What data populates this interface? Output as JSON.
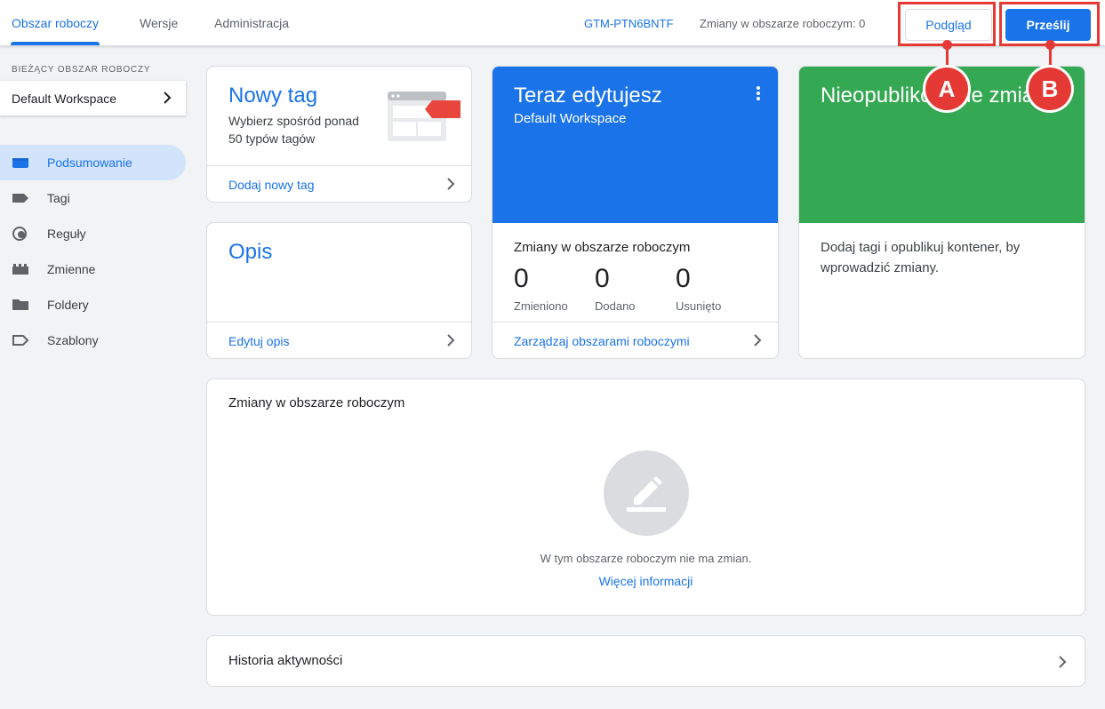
{
  "header": {
    "tabs": [
      {
        "label": "Obszar roboczy"
      },
      {
        "label": "Wersje"
      },
      {
        "label": "Administracja"
      }
    ],
    "container_id": "GTM-PTN6BNTF",
    "changes_count": "Zmiany w obszarze roboczym: 0",
    "preview_label": "Podgląd",
    "submit_label": "Prześlij"
  },
  "annotations": {
    "a": "A",
    "b": "B",
    "color": "#e53935"
  },
  "sidebar": {
    "workspace_label": "BIEŻĄCY OBSZAR ROBOCZY",
    "workspace_name": "Default Workspace",
    "items": [
      {
        "label": "Podsumowanie",
        "icon": "overview-icon"
      },
      {
        "label": "Tagi",
        "icon": "tag-icon"
      },
      {
        "label": "Reguły",
        "icon": "trigger-icon"
      },
      {
        "label": "Zmienne",
        "icon": "variables-icon"
      },
      {
        "label": "Foldery",
        "icon": "folder-icon"
      },
      {
        "label": "Szablony",
        "icon": "template-icon"
      }
    ]
  },
  "new_tag_card": {
    "title": "Nowy tag",
    "description": "Wybierz spośród ponad 50 typów tagów",
    "link": "Dodaj nowy tag"
  },
  "description_card": {
    "title": "Opis",
    "link": "Edytuj opis"
  },
  "editing_card": {
    "title": "Teraz edytujesz",
    "workspace": "Default Workspace",
    "changes_heading": "Zmiany w obszarze roboczym",
    "stats": [
      {
        "value": "0",
        "label": "Zmieniono"
      },
      {
        "value": "0",
        "label": "Dodano"
      },
      {
        "value": "0",
        "label": "Usunięto"
      }
    ],
    "link": "Zarządzaj obszarami roboczymi",
    "color": "#1a73e8"
  },
  "unpublished_card": {
    "title": "Nieopublikowane zmiany",
    "description": "Dodaj tagi i opublikuj kontener, by wprowadzić zmiany.",
    "color": "#34a853"
  },
  "workspace_changes": {
    "heading": "Zmiany w obszarze roboczym",
    "empty_text": "W tym obszarze roboczym nie ma zmian.",
    "more_info": "Więcej informacji"
  },
  "activity_history": {
    "label": "Historia aktywności"
  }
}
